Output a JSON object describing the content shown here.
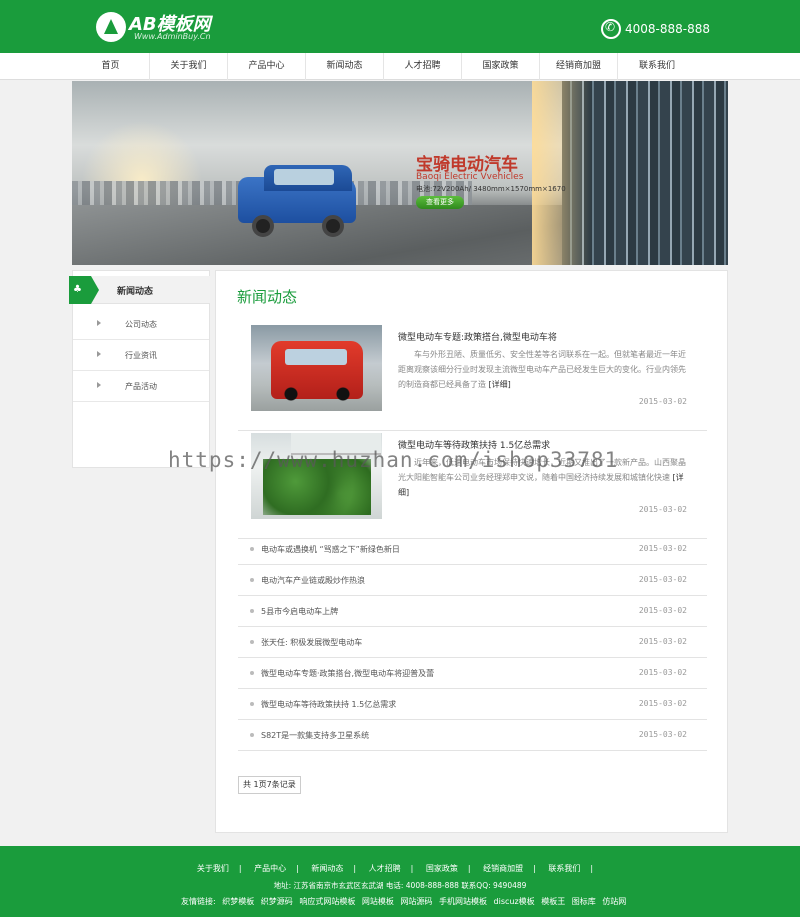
{
  "header": {
    "logo_text": "AB模板网",
    "logo_sub": "Www.AdminBuy.Cn",
    "phone": "4008-888-888"
  },
  "nav": {
    "items": [
      {
        "label": "首页"
      },
      {
        "label": "关于我们"
      },
      {
        "label": "产品中心"
      },
      {
        "label": "新闻动态"
      },
      {
        "label": "人才招聘"
      },
      {
        "label": "国家政策"
      },
      {
        "label": "经销商加盟"
      },
      {
        "label": "联系我们"
      }
    ]
  },
  "banner": {
    "title": "宝骑电动汽车",
    "subtitle": "Baoqi Electric Vvehicles",
    "spec": "电池:72V200Ah/ 3480mm×1570mm×1670",
    "button": "查看更多"
  },
  "sidebar": {
    "title": "新闻动态",
    "items": [
      {
        "label": "公司动态"
      },
      {
        "label": "行业资讯"
      },
      {
        "label": "产品活动"
      }
    ]
  },
  "main": {
    "title": "新闻动态",
    "features": [
      {
        "title": "微型电动车专题:政策搭台,微型电动车将",
        "desc": "车与外形丑陋、质量低劣、安全性差等名词联系在一起。但就笔者最近一年近距离观察该细分行业时发现主流微型电动车产品已经发生巨大的变化。行业内领先的制造商都已经具备了造",
        "more": "[详细]",
        "date": "2015-03-02"
      },
      {
        "title": "微型电动车等待政策扶持 1.5亿总需求",
        "desc": "近年来，低速电动车市场保持快速增长，近期又推出了一款新产品。山西聚晶光大阳能智能车公司业务经理郑申文说，随着中国经济持续发展和城镇化快速",
        "more": "[详细]",
        "date": "2015-03-02"
      }
    ],
    "list": [
      {
        "title": "电动车或遇换机 “骂惑之下”新绿色新日",
        "date": "2015-03-02"
      },
      {
        "title": "电动汽车产业链或殿炒作热浪",
        "date": "2015-03-02"
      },
      {
        "title": "5县市今启电动车上牌",
        "date": "2015-03-02"
      },
      {
        "title": "张天任: 积极发展微型电动车",
        "date": "2015-03-02"
      },
      {
        "title": "微型电动车专题·政策搭台,微型电动车将迎普及蕾",
        "date": "2015-03-02"
      },
      {
        "title": "微型电动车等待政策扶持 1.5亿总需求",
        "date": "2015-03-02"
      },
      {
        "title": "S82T是一款集支持多卫星系统",
        "date": "2015-03-02"
      }
    ],
    "pager": "共 1页7条记录"
  },
  "watermark": "https://www.huzhan.com/ishop33781",
  "footer": {
    "nav": [
      "关于我们",
      "产品中心",
      "新闻动态",
      "人才招聘",
      "国家政策",
      "经销商加盟",
      "联系我们"
    ],
    "address": "地址: 江苏省南京市玄武区玄武湖  电话: 4008-888-888  联系QQ: 9490489",
    "links_label": "友情链接:",
    "links": [
      "织梦模板",
      "织梦源码",
      "响应式网站模板",
      "网站模板",
      "网站源码",
      "手机网站模板",
      "discuz模板",
      "模板王",
      "图标库",
      "仿站网"
    ]
  },
  "colors": {
    "brand_green": "#1a9c3c",
    "banner_red": "#c0392b"
  }
}
